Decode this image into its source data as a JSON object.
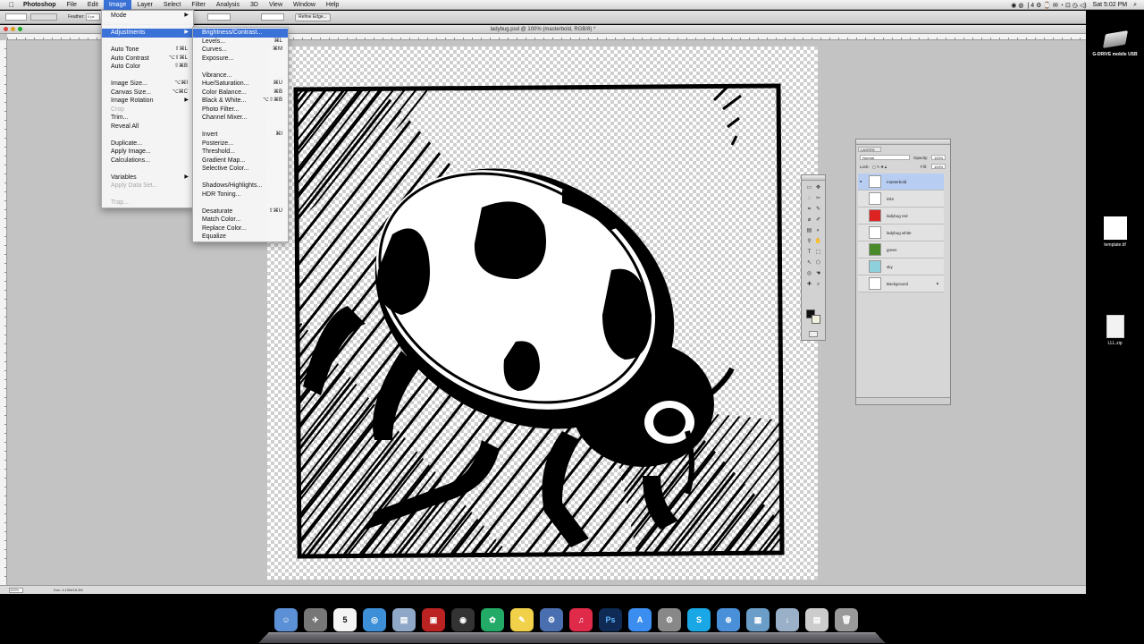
{
  "menubar": {
    "apple": "",
    "items": [
      "Photoshop",
      "File",
      "Edit",
      "Image",
      "Layer",
      "Select",
      "Filter",
      "Analysis",
      "3D",
      "View",
      "Window",
      "Help"
    ],
    "active": "Image",
    "clock": "Sat 5:02 PM"
  },
  "options_bar": {
    "feather_label": "Feather:",
    "feather_value": "0 px",
    "refine_edge": "Refine Edge..."
  },
  "document": {
    "title": "ladybug.psd @ 100% (masterbold, RGB/8) *",
    "zoom": "100%",
    "doc_info": "Doc: 4.19M/18.3M"
  },
  "image_menu": {
    "items": [
      {
        "label": "Mode",
        "submenu": true
      },
      {
        "sep": true
      },
      {
        "label": "Adjustments",
        "submenu": true,
        "selected": true
      },
      {
        "sep": true
      },
      {
        "label": "Auto Tone",
        "shortcut": "⇧⌘L"
      },
      {
        "label": "Auto Contrast",
        "shortcut": "⌥⇧⌘L"
      },
      {
        "label": "Auto Color",
        "shortcut": "⇧⌘B"
      },
      {
        "sep": true
      },
      {
        "label": "Image Size...",
        "shortcut": "⌥⌘I"
      },
      {
        "label": "Canvas Size...",
        "shortcut": "⌥⌘C"
      },
      {
        "label": "Image Rotation",
        "submenu": true
      },
      {
        "label": "Crop",
        "disabled": true
      },
      {
        "label": "Trim..."
      },
      {
        "label": "Reveal All"
      },
      {
        "sep": true
      },
      {
        "label": "Duplicate..."
      },
      {
        "label": "Apply Image..."
      },
      {
        "label": "Calculations..."
      },
      {
        "sep": true
      },
      {
        "label": "Variables",
        "submenu": true
      },
      {
        "label": "Apply Data Set...",
        "disabled": true
      },
      {
        "sep": true
      },
      {
        "label": "Trap...",
        "disabled": true
      }
    ]
  },
  "adjustments_menu": {
    "items": [
      {
        "label": "Brightness/Contrast...",
        "selected": true
      },
      {
        "label": "Levels...",
        "shortcut": "⌘L"
      },
      {
        "label": "Curves...",
        "shortcut": "⌘M"
      },
      {
        "label": "Exposure..."
      },
      {
        "sep": true
      },
      {
        "label": "Vibrance..."
      },
      {
        "label": "Hue/Saturation...",
        "shortcut": "⌘U"
      },
      {
        "label": "Color Balance...",
        "shortcut": "⌘B"
      },
      {
        "label": "Black & White...",
        "shortcut": "⌥⇧⌘B"
      },
      {
        "label": "Photo Filter..."
      },
      {
        "label": "Channel Mixer..."
      },
      {
        "sep": true
      },
      {
        "label": "Invert",
        "shortcut": "⌘I"
      },
      {
        "label": "Posterize..."
      },
      {
        "label": "Threshold..."
      },
      {
        "label": "Gradient Map..."
      },
      {
        "label": "Selective Color..."
      },
      {
        "sep": true
      },
      {
        "label": "Shadows/Highlights..."
      },
      {
        "label": "HDR Toning..."
      },
      {
        "sep": true
      },
      {
        "label": "Desaturate",
        "shortcut": "⇧⌘U"
      },
      {
        "label": "Match Color..."
      },
      {
        "label": "Replace Color..."
      },
      {
        "label": "Equalize"
      }
    ]
  },
  "layers_panel": {
    "tab": "LAYERS",
    "blend_mode": "Normal",
    "opacity_label": "Opacity:",
    "opacity": "100%",
    "lock_label": "Lock:",
    "fill_label": "Fill:",
    "fill": "100%",
    "layers": [
      {
        "name": "masterbold",
        "selected": true,
        "visible": true
      },
      {
        "name": "inks",
        "visible": false
      },
      {
        "name": "ladybug red",
        "visible": false
      },
      {
        "name": "ladybug white",
        "visible": false
      },
      {
        "name": "green",
        "visible": false
      },
      {
        "name": "sky",
        "visible": false
      },
      {
        "name": "Background",
        "visible": false,
        "locked": true
      }
    ]
  },
  "desktop": {
    "icons": [
      {
        "name": "drive",
        "label": "G-DRIVE mobile USB"
      },
      {
        "name": "tif",
        "label": "template.tif"
      },
      {
        "name": "zip",
        "label": "LLL.zip"
      }
    ]
  },
  "dock": {
    "apps": [
      "Finder",
      "Launchpad",
      "Calendar",
      "Safari",
      "Preview",
      "Photo Booth",
      "Dashboard",
      "Photos",
      "Stickies",
      "Instruments",
      "iTunes",
      "Photoshop",
      "App Store",
      "System Preferences",
      "Skype",
      "Network",
      "Applications",
      "Downloads",
      "Preview",
      "Trash"
    ],
    "calendar_day": "5",
    "ps_label": "Ps",
    "skype_label": "S"
  }
}
